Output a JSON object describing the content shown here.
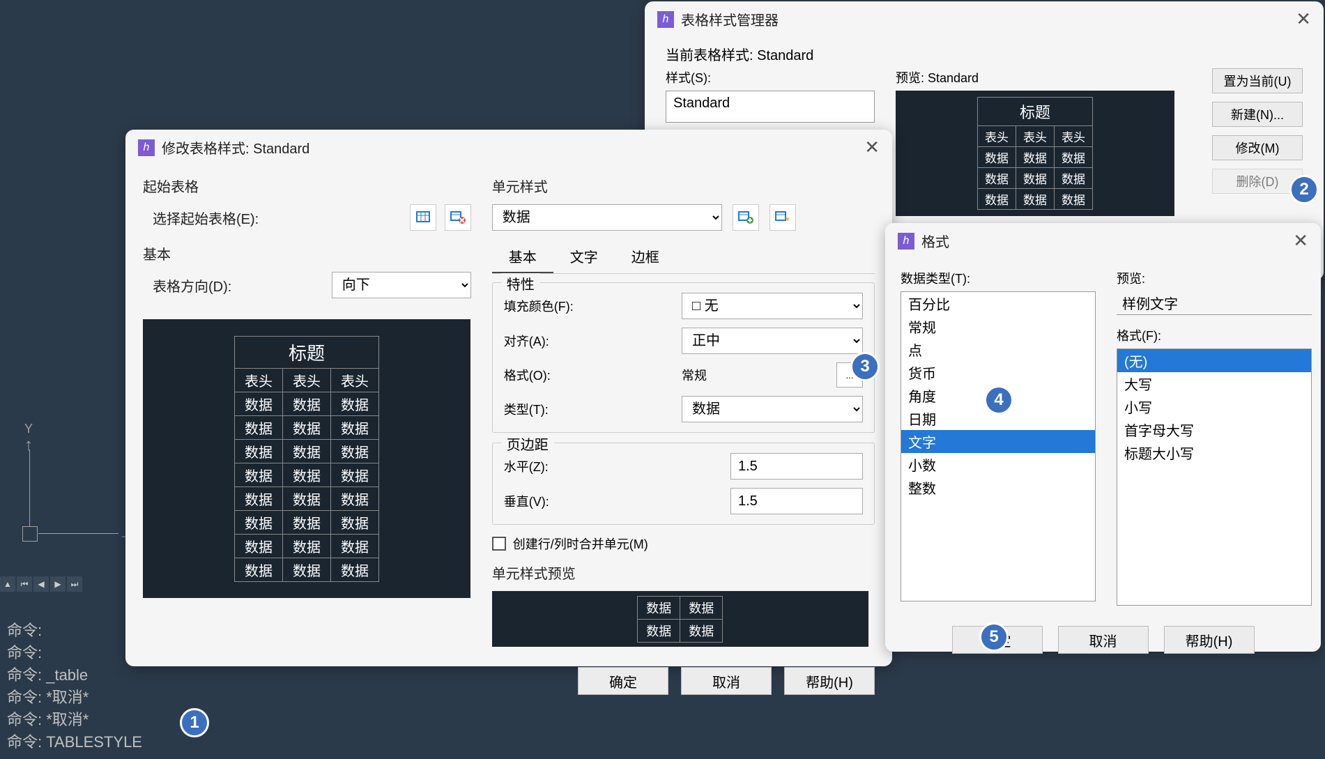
{
  "commands": {
    "c1": "命令:",
    "c2": "命令:",
    "c3": "命令: _table",
    "c4": "命令: *取消*",
    "c5": "命令: *取消*",
    "c6": "命令: TABLESTYLE"
  },
  "axis": {
    "y": "Y"
  },
  "manager": {
    "title": "表格样式管理器",
    "current_label": "当前表格样式: Standard",
    "styles_label": "样式(S):",
    "list_item": "Standard",
    "preview_label": "预览: Standard",
    "btn_set_current": "置为当前(U)",
    "btn_new": "新建(N)...",
    "btn_modify": "修改(M)",
    "btn_delete": "删除(D)"
  },
  "modify": {
    "title": "修改表格样式: Standard",
    "start_section": "起始表格",
    "select_start": "选择起始表格(E):",
    "basic_section": "基本",
    "direction_label": "表格方向(D):",
    "direction_value": "向下",
    "cell_style_section": "单元样式",
    "cell_style_value": "数据",
    "tabs": {
      "basic": "基本",
      "text": "文字",
      "border": "边框"
    },
    "properties": "特性",
    "fill_label": "填充颜色(F):",
    "fill_value": "无",
    "align_label": "对齐(A):",
    "align_value": "正中",
    "format_label": "格式(O):",
    "format_value": "常规",
    "type_label": "类型(T):",
    "type_value": "数据",
    "margin_section": "页边距",
    "hz_label": "水平(Z):",
    "hz_value": "1.5",
    "vt_label": "垂直(V):",
    "vt_value": "1.5",
    "merge_label": "创建行/列时合并单元(M)",
    "cell_preview_label": "单元样式预览",
    "btn_ok": "确定",
    "btn_cancel": "取消",
    "btn_help": "帮助(H)"
  },
  "format": {
    "title": "格式",
    "data_type_label": "数据类型(T):",
    "types": [
      "百分比",
      "常规",
      "点",
      "货币",
      "角度",
      "日期",
      "文字",
      "小数",
      "整数"
    ],
    "selected_type_index": 6,
    "preview_label": "预览:",
    "sample_text": "样例文字",
    "format_label": "格式(F):",
    "formats": [
      "(无)",
      "大写",
      "小写",
      "首字母大写",
      "标题大小写"
    ],
    "selected_format_index": 0,
    "btn_ok": "确定",
    "btn_cancel": "取消",
    "btn_help": "帮助(H)"
  },
  "table_preview": {
    "title": "标题",
    "header": "表头",
    "data": "数据"
  },
  "badges": {
    "b1": "1",
    "b2": "2",
    "b3": "3",
    "b4": "4",
    "b5": "5"
  }
}
